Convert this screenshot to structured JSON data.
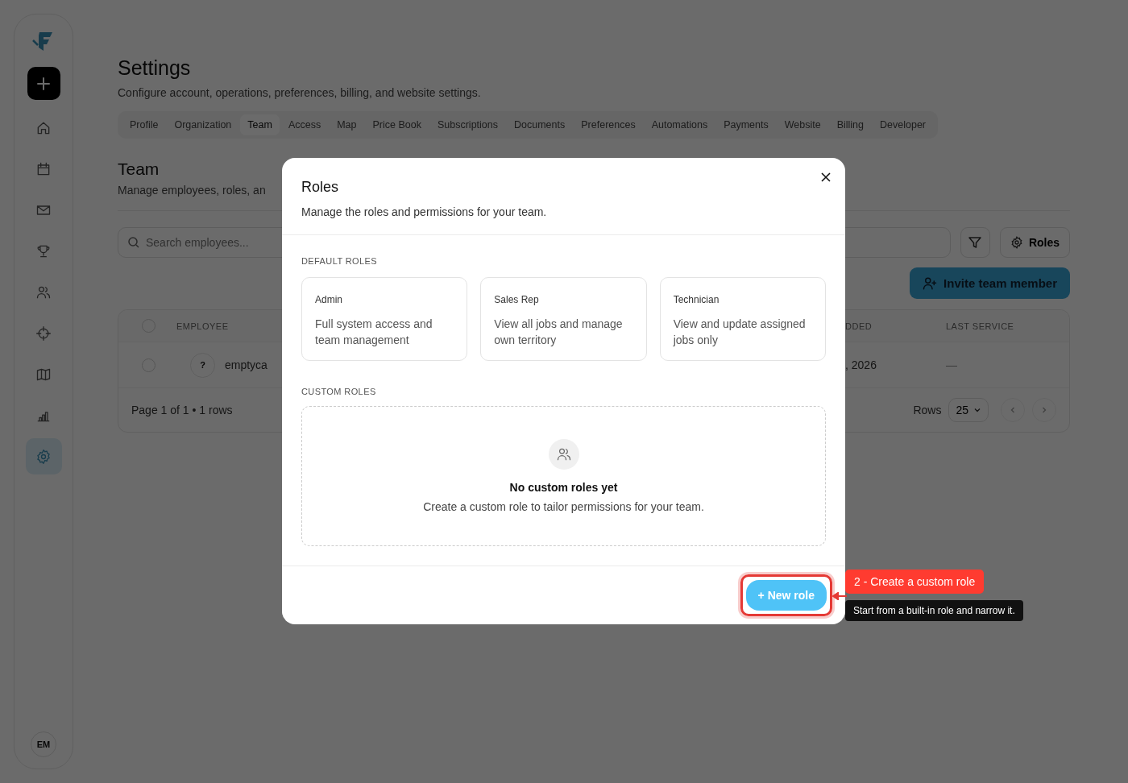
{
  "sidebar": {
    "nav": [
      {
        "kind": "home",
        "selected": false
      },
      {
        "kind": "calendar",
        "selected": false
      },
      {
        "kind": "mail",
        "selected": false
      },
      {
        "kind": "trophy",
        "selected": false
      },
      {
        "kind": "users",
        "selected": false
      },
      {
        "kind": "target",
        "selected": false
      },
      {
        "kind": "map",
        "selected": false
      },
      {
        "kind": "chart",
        "selected": false
      },
      {
        "kind": "settings",
        "selected": true
      }
    ],
    "avatar": "EM"
  },
  "page": {
    "title": "Settings",
    "subtitle": "Configure account, operations, preferences, billing, and website settings."
  },
  "tabs": [
    {
      "label": "Profile",
      "selected": false
    },
    {
      "label": "Organization",
      "selected": false
    },
    {
      "label": "Team",
      "selected": true
    },
    {
      "label": "Access",
      "selected": false
    },
    {
      "label": "Map",
      "selected": false
    },
    {
      "label": "Price Book",
      "selected": false
    },
    {
      "label": "Subscriptions",
      "selected": false
    },
    {
      "label": "Documents",
      "selected": false
    },
    {
      "label": "Preferences",
      "selected": false
    },
    {
      "label": "Automations",
      "selected": false
    },
    {
      "label": "Payments",
      "selected": false
    },
    {
      "label": "Website",
      "selected": false
    },
    {
      "label": "Billing",
      "selected": false
    },
    {
      "label": "Developer",
      "selected": false
    }
  ],
  "team": {
    "title": "Team",
    "subtitle": "Manage employees, roles, an",
    "search": {
      "placeholder": "Search employees..."
    },
    "roles_button": "Roles",
    "invite_button": "Invite team member"
  },
  "table": {
    "select_all": false,
    "columns": [
      "EMPLOYEE",
      "DDED",
      "LAST SERVICE"
    ],
    "rows": [
      {
        "checked": false,
        "avatar": "?",
        "employee": "emptyca",
        "added": ", 2026",
        "last_service": "—"
      }
    ],
    "footer": "Page 1 of 1 • 1 rows",
    "rows_label": "Rows",
    "page_size": "25"
  },
  "modal": {
    "title": "Roles",
    "subtitle": "Manage the roles and permissions for your team.",
    "default_label": "DEFAULT ROLES",
    "default_roles": [
      {
        "name": "Admin",
        "description": "Full system access and team management"
      },
      {
        "name": "Sales Rep",
        "description": "View all jobs and manage own territory"
      },
      {
        "name": "Technician",
        "description": "View and update assigned jobs only"
      }
    ],
    "custom_label": "CUSTOM ROLES",
    "empty": {
      "title": "No custom roles yet",
      "text": "Create a custom role to tailor permissions for your team."
    },
    "new_button": "+ New role"
  },
  "annotation": {
    "label": "2 - Create a custom role",
    "tooltip": "Start from a built-in role and narrow it."
  }
}
